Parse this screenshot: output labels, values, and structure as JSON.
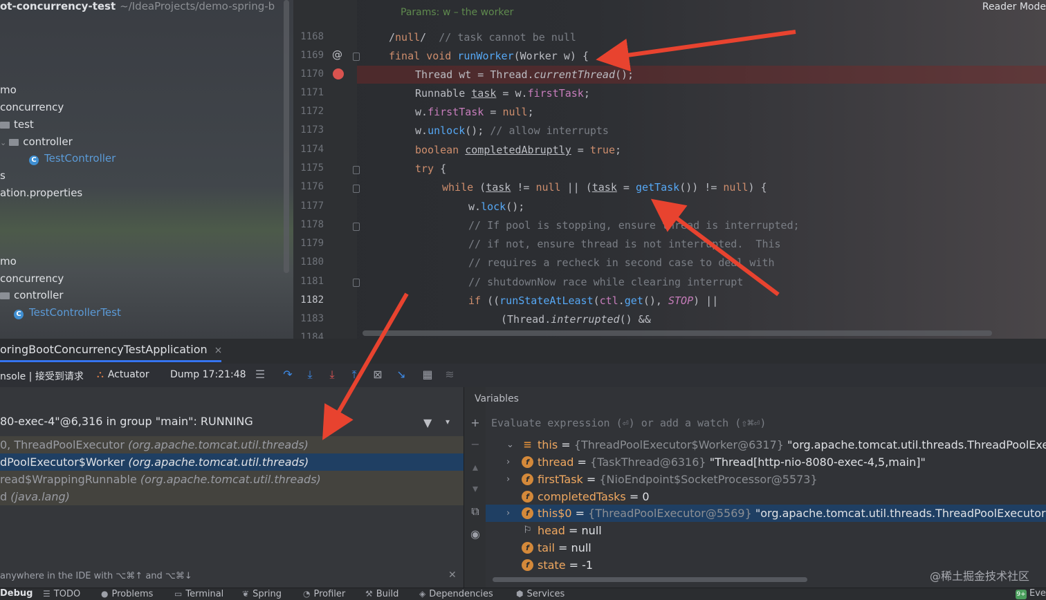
{
  "project": {
    "root_name": "ot-concurrency-test",
    "root_path": "~/IdeaProjects/demo-spring-b",
    "items": [
      {
        "label": "mo",
        "kind": "text"
      },
      {
        "label": "concurrency",
        "kind": "text"
      },
      {
        "label": "test",
        "kind": "folder"
      },
      {
        "label": "controller",
        "kind": "folder"
      },
      {
        "label": "TestController",
        "kind": "class"
      },
      {
        "label": "s",
        "kind": "text"
      },
      {
        "label": "ation.properties",
        "kind": "text"
      },
      {
        "label": "mo",
        "kind": "text"
      },
      {
        "label": "concurrency",
        "kind": "text"
      },
      {
        "label": "controller",
        "kind": "folder"
      },
      {
        "label": "TestControllerTest",
        "kind": "class"
      }
    ]
  },
  "editor": {
    "reader_mode": "Reader Mode",
    "doc_params": "Params: w – the worker",
    "line_numbers": [
      "1168",
      "1169",
      "1170",
      "1171",
      "1172",
      "1173",
      "1174",
      "1175",
      "1176",
      "1177",
      "1178",
      "1179",
      "1180",
      "1181",
      "1182",
      "1183",
      "1184"
    ],
    "lines": [
      "/null/  // task cannot be null",
      "final void runWorker(Worker w) {",
      "Thread wt = Thread.currentThread();",
      "Runnable task = w.firstTask;",
      "w.firstTask = null;",
      "w.unlock(); // allow interrupts",
      "boolean completedAbruptly = true;",
      "try {",
      "while (task != null || (task = getTask()) != null) {",
      "w.lock();",
      "// If pool is stopping, ensure thread is interrupted;",
      "// if not, ensure thread is not interrupted.  This",
      "// requires a recheck in second case to deal with",
      "// shutdownNow race while clearing interrupt",
      "if ((runStateAtLeast(ctl.get(), STOP) ||",
      "(Thread.interrupted() &&"
    ]
  },
  "debug": {
    "tab_title": "oringBootConcurrencyTestApplication",
    "tab_close": "×",
    "toolbar": {
      "console_label": "nsole | 接受到请求",
      "actuator_label": "Actuator",
      "dump_label": "Dump 17:21:48"
    },
    "thread_selector": "80-exec-4\"@6,316 in group \"main\": RUNNING",
    "frames": [
      {
        "method": "0, ThreadPoolExecutor",
        "pkg": "(org.apache.tomcat.util.threads)"
      },
      {
        "method": "dPoolExecutor$Worker",
        "pkg": "(org.apache.tomcat.util.threads)"
      },
      {
        "method": "read$WrappingRunnable",
        "pkg": "(org.apache.tomcat.util.threads)"
      },
      {
        "method": "d",
        "pkg": "(java.lang)"
      }
    ],
    "search_hint": "anywhere in the IDE with ⌥⌘↑ and ⌥⌘↓",
    "variables": {
      "title": "Variables",
      "eval_placeholder": "Evaluate expression (⏎) or add a watch (⇧⌘⏎)",
      "rows": [
        {
          "name": "this",
          "type": "{ThreadPoolExecutor$Worker@6317}",
          "value": "\"org.apache.tomcat.util.threads.ThreadPoolExecuto...",
          "icon": "bars"
        },
        {
          "name": "thread",
          "type": "{TaskThread@6316}",
          "value": "\"Thread[http-nio-8080-exec-4,5,main]\"",
          "icon": "field"
        },
        {
          "name": "firstTask",
          "type": "{NioEndpoint$SocketProcessor@5573}",
          "value": "",
          "icon": "field"
        },
        {
          "name": "completedTasks",
          "type": "",
          "value": "0",
          "icon": "field"
        },
        {
          "name": "this$0",
          "type": "{ThreadPoolExecutor@5569}",
          "value": "\"org.apache.tomcat.util.threads.ThreadPoolExecutor@...",
          "icon": "field"
        },
        {
          "name": "head",
          "type": "",
          "value": "null",
          "icon": "flag"
        },
        {
          "name": "tail",
          "type": "",
          "value": "null",
          "icon": "field"
        },
        {
          "name": "state",
          "type": "",
          "value": "-1",
          "icon": "field"
        }
      ]
    }
  },
  "bottom_bar": {
    "items": [
      "Debug",
      "TODO",
      "Problems",
      "Terminal",
      "Spring",
      "Profiler",
      "Build",
      "Dependencies",
      "Services",
      "Eve"
    ]
  },
  "watermark": "@稀土掘金技术社区",
  "colors": {
    "accent": "#3574f0",
    "selection": "#1f3f63",
    "breakpoint": "#d9534f",
    "arrow": "#e8432f"
  }
}
